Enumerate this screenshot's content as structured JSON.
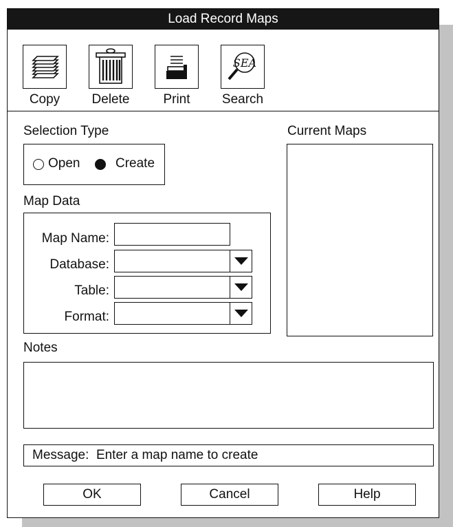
{
  "window": {
    "title": "Load Record Maps"
  },
  "toolbar": {
    "items": [
      {
        "label": "Copy",
        "icon": "copy-icon"
      },
      {
        "label": "Delete",
        "icon": "trash-icon"
      },
      {
        "label": "Print",
        "icon": "printer-icon"
      },
      {
        "label": "Search",
        "icon": "magnifier-icon"
      }
    ]
  },
  "selection_type": {
    "label": "Selection Type",
    "options": [
      {
        "label": "Open",
        "selected": false
      },
      {
        "label": "Create",
        "selected": true
      }
    ]
  },
  "map_data": {
    "label": "Map Data",
    "map_name": {
      "label": "Map Name:",
      "value": ""
    },
    "database": {
      "label": "Database:",
      "value": ""
    },
    "table": {
      "label": "Table:",
      "value": ""
    },
    "format": {
      "label": "Format:",
      "value": ""
    }
  },
  "current_maps": {
    "label": "Current Maps",
    "items": []
  },
  "notes": {
    "label": "Notes",
    "value": ""
  },
  "message": {
    "label": "Message:",
    "text": "Enter a map name to create"
  },
  "buttons": {
    "ok": "OK",
    "cancel": "Cancel",
    "help": "Help"
  }
}
